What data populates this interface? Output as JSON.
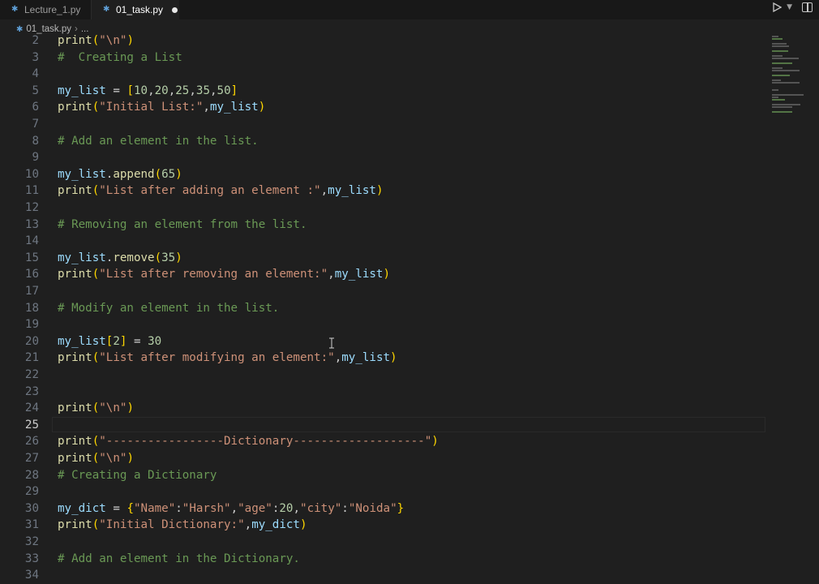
{
  "tabs": [
    {
      "label": "Lecture_1.py",
      "active": false
    },
    {
      "label": "01_task.py",
      "active": true,
      "modified": true
    }
  ],
  "breadcrumb": {
    "file": "01_task.py",
    "more": "..."
  },
  "icons": {
    "file": "python-file-icon",
    "run": "run-icon",
    "run_menu": "chevron-down-icon",
    "split": "split-editor-icon"
  },
  "colors": {
    "function": "#dcdcaa",
    "string": "#ce9178",
    "number": "#b5cea8",
    "variable": "#9cdcfe",
    "comment": "#6a9955",
    "bracket1": "#ffd700",
    "bracket2": "#da70d6"
  },
  "editor": {
    "current_line": 25,
    "lines": [
      {
        "n": "2",
        "t": "print(\"\\n\")"
      },
      {
        "n": "3",
        "t": "#  Creating a List"
      },
      {
        "n": "4",
        "t": ""
      },
      {
        "n": "5",
        "t": "my_list = [10,20,25,35,50]"
      },
      {
        "n": "6",
        "t": "print(\"Initial List:\",my_list)"
      },
      {
        "n": "7",
        "t": ""
      },
      {
        "n": "8",
        "t": "# Add an element in the list."
      },
      {
        "n": "9",
        "t": ""
      },
      {
        "n": "10",
        "t": "my_list.append(65)"
      },
      {
        "n": "11",
        "t": "print(\"List after adding an element :\",my_list)"
      },
      {
        "n": "12",
        "t": ""
      },
      {
        "n": "13",
        "t": "# Removing an element from the list."
      },
      {
        "n": "14",
        "t": ""
      },
      {
        "n": "15",
        "t": "my_list.remove(35)"
      },
      {
        "n": "16",
        "t": "print(\"List after removing an element:\",my_list)"
      },
      {
        "n": "17",
        "t": ""
      },
      {
        "n": "18",
        "t": "# Modify an element in the list."
      },
      {
        "n": "19",
        "t": ""
      },
      {
        "n": "20",
        "t": "my_list[2] = 30"
      },
      {
        "n": "21",
        "t": "print(\"List after modifying an element:\",my_list)"
      },
      {
        "n": "22",
        "t": ""
      },
      {
        "n": "23",
        "t": ""
      },
      {
        "n": "24",
        "t": "print(\"\\n\")"
      },
      {
        "n": "25",
        "t": ""
      },
      {
        "n": "26",
        "t": "print(\"-----------------Dictionary-------------------\")"
      },
      {
        "n": "27",
        "t": "print(\"\\n\")"
      },
      {
        "n": "28",
        "t": "# Creating a Dictionary"
      },
      {
        "n": "29",
        "t": ""
      },
      {
        "n": "30",
        "t": "my_dict = {\"Name\":\"Harsh\",\"age\":20,\"city\":\"Noida\"}"
      },
      {
        "n": "31",
        "t": "print(\"Initial Dictionary:\",my_dict)"
      },
      {
        "n": "32",
        "t": ""
      },
      {
        "n": "33",
        "t": "# Add an element in the Dictionary."
      },
      {
        "n": "34",
        "t": ""
      }
    ]
  }
}
